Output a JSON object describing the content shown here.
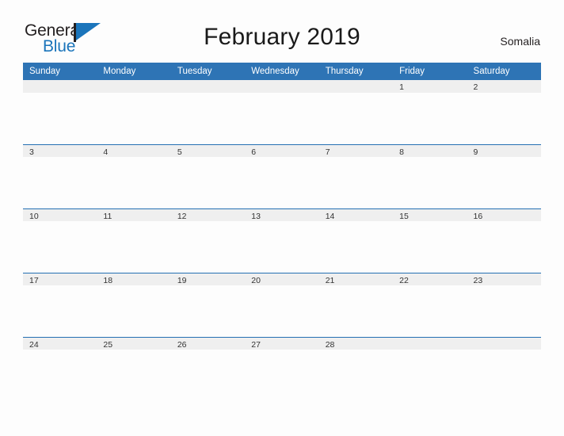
{
  "brand": {
    "name_part1": "General",
    "name_part2": "Blue",
    "flag_color": "#1b75bb",
    "text_color": "#231f20"
  },
  "header": {
    "title": "February 2019",
    "country": "Somalia"
  },
  "theme": {
    "header_blue": "#2e74b5",
    "rule_blue": "#2470b3",
    "band_gray": "#efefef",
    "page_background": "#fdfdfd",
    "day_number_color": "#333333"
  },
  "calendar": {
    "month": "February",
    "year": "2019",
    "weekday_headers": [
      "Sunday",
      "Monday",
      "Tuesday",
      "Wednesday",
      "Thursday",
      "Friday",
      "Saturday"
    ],
    "weeks": [
      [
        "",
        "",
        "",
        "",
        "",
        "1",
        "2"
      ],
      [
        "3",
        "4",
        "5",
        "6",
        "7",
        "8",
        "9"
      ],
      [
        "10",
        "11",
        "12",
        "13",
        "14",
        "15",
        "16"
      ],
      [
        "17",
        "18",
        "19",
        "20",
        "21",
        "22",
        "23"
      ],
      [
        "24",
        "25",
        "26",
        "27",
        "28",
        "",
        ""
      ]
    ]
  }
}
